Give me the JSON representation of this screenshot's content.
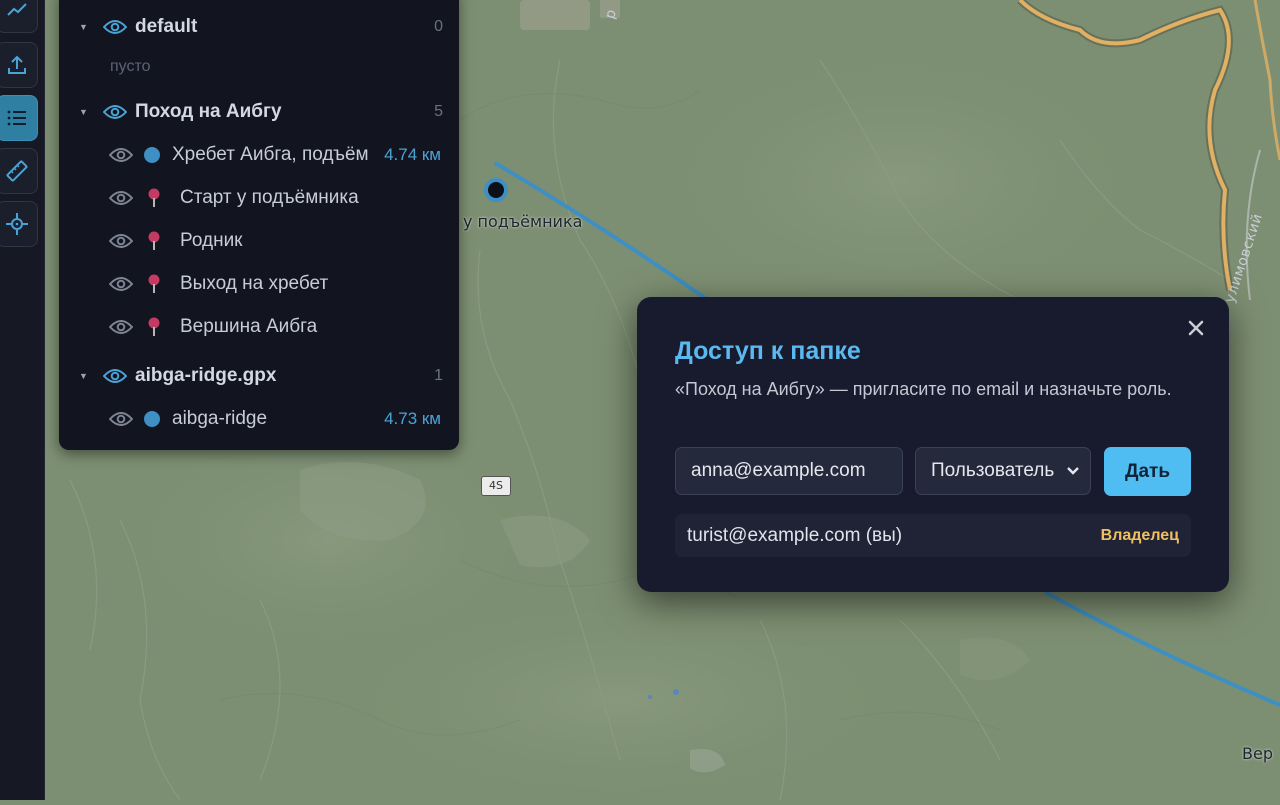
{
  "map": {
    "marker_label": "у подъёмника",
    "road_shield": "4S",
    "road_name": "улимовский",
    "road_top_fragment": "р",
    "edge_label": "Вер",
    "colors": {
      "terrain": "#7d8f72",
      "track": "#3d8fc4",
      "road": "#e1b062"
    }
  },
  "toolbar": {
    "buttons": [
      {
        "icon": "chart-line-icon",
        "active": false
      },
      {
        "icon": "upload-icon",
        "active": false
      },
      {
        "icon": "list-icon",
        "active": true
      },
      {
        "icon": "ruler-icon",
        "active": false
      },
      {
        "icon": "crosshair-icon",
        "active": false
      }
    ]
  },
  "layers": {
    "folders": [
      {
        "name": "default",
        "count": "0",
        "empty_label": "пусто",
        "items": []
      },
      {
        "name": "Поход на Аибгу",
        "count": "5",
        "items": [
          {
            "type": "track",
            "name": "Хребет Аибга, подъём",
            "distance": "4.74 км"
          },
          {
            "type": "point",
            "name": "Старт у подъёмника"
          },
          {
            "type": "point",
            "name": "Родник"
          },
          {
            "type": "point",
            "name": "Выход на хребет"
          },
          {
            "type": "point",
            "name": "Вершина Аибга"
          }
        ]
      },
      {
        "name": "aibga-ridge.gpx",
        "count": "1",
        "items": [
          {
            "type": "track",
            "name": "aibga-ridge",
            "distance": "4.73 км"
          }
        ]
      }
    ]
  },
  "dialog": {
    "title": "Доступ к папке",
    "description": "«Поход на Аибгу» — пригласите по email и назначьте роль.",
    "email_value": "anna@example.com",
    "role_selected": "Пользователь",
    "submit_label": "Дать",
    "members": [
      {
        "email": "turist@example.com (вы)",
        "role": "Владелец"
      }
    ],
    "colors": {
      "title": "#5ab9ee",
      "submit": "#4fbdf1",
      "owner": "#f0c060"
    }
  }
}
